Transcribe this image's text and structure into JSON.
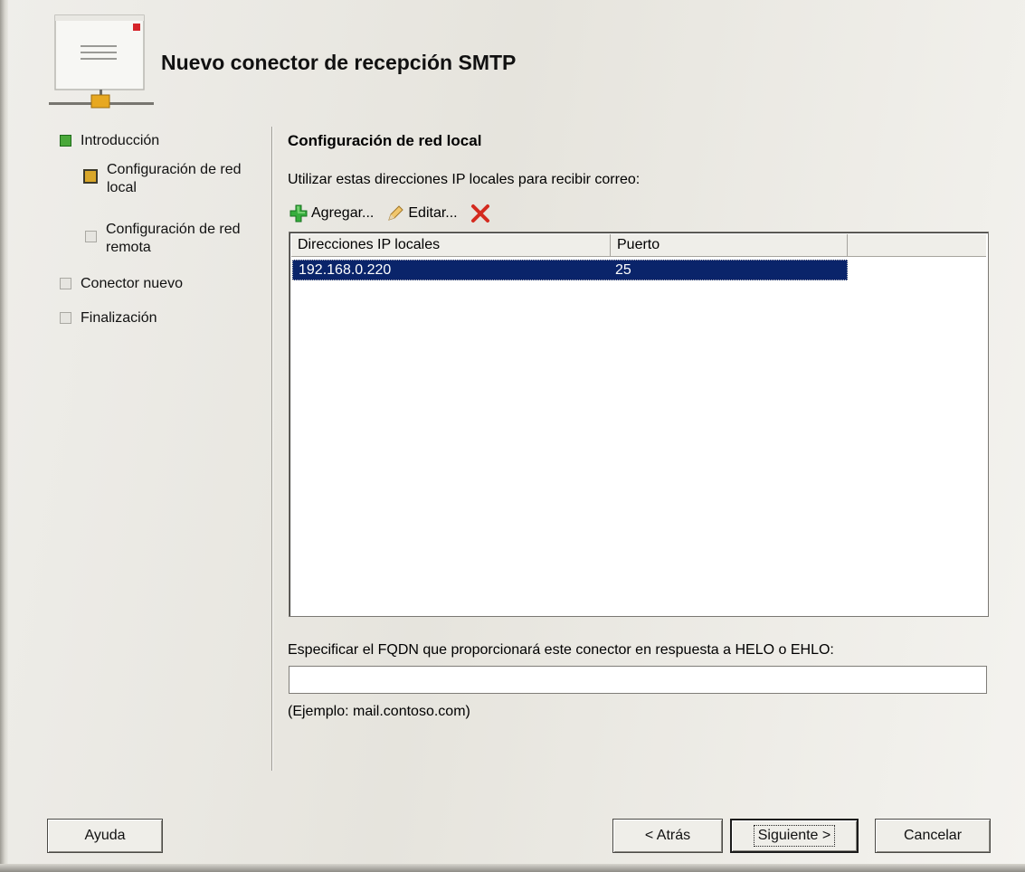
{
  "title": "Nuevo conector de recepción SMTP",
  "sidebar": {
    "items": [
      {
        "label": "Introducción",
        "state": "completed",
        "color": "#4aa83a"
      },
      {
        "label": "Configuración de red local",
        "state": "current",
        "color": "#d9a72a"
      },
      {
        "label": "Configuración de red remota",
        "state": "pending"
      },
      {
        "label": "Conector nuevo",
        "state": "pending"
      },
      {
        "label": "Finalización",
        "state": "pending"
      }
    ]
  },
  "main": {
    "section_title": "Configuración de red local",
    "description": "Utilizar estas direcciones IP locales para recibir correo:",
    "toolbar": {
      "add_label": "Agregar...",
      "edit_label": "Editar...",
      "add_icon": "plus-icon",
      "edit_icon": "pencil-icon",
      "delete_icon": "delete-x-icon"
    },
    "table": {
      "columns": [
        "Direcciones IP locales",
        "Puerto"
      ],
      "rows": [
        {
          "ip": "192.168.0.220",
          "port": "25",
          "selected": true
        }
      ]
    },
    "fqdn": {
      "label": "Especificar el FQDN que proporcionará este conector en respuesta a HELO o EHLO:",
      "value": "",
      "hint": "(Ejemplo: mail.contoso.com)"
    }
  },
  "buttons": {
    "help": "Ayuda",
    "back": "< Atrás",
    "next": "Siguiente >",
    "cancel": "Cancelar"
  },
  "colors": {
    "selection": "#0a246a",
    "delete": "#d42a1f",
    "add": "#2ea23a"
  }
}
